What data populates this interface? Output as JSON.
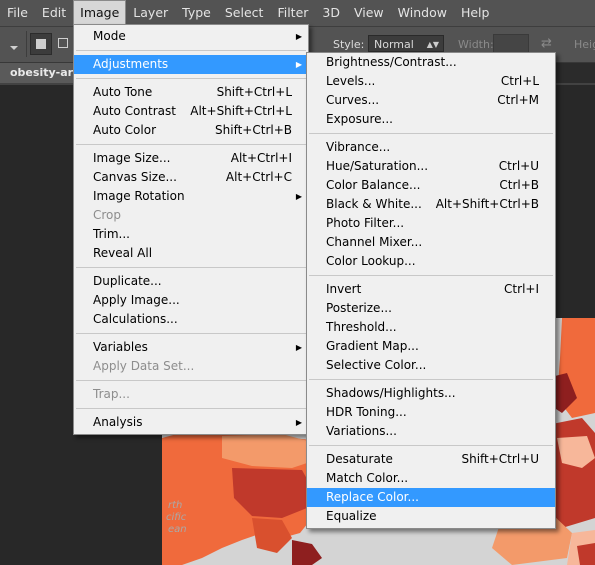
{
  "menubar": {
    "items": [
      "File",
      "Edit",
      "Image",
      "Layer",
      "Type",
      "Select",
      "Filter",
      "3D",
      "View",
      "Window",
      "Help"
    ],
    "active": "Image"
  },
  "optionsbar": {
    "style_label": "Style:",
    "style_value": "Normal",
    "width_label": "Width:",
    "height_label": "Heig"
  },
  "document": {
    "tab_label": "obesity-arou"
  },
  "map": {
    "labels": [
      "rth",
      "cific",
      "ean"
    ],
    "colors": {
      "sea": "#d4d4d4",
      "light": "#f7b79a",
      "mid": "#f06a3c",
      "dark": "#c0392b",
      "deep": "#8e1f1f",
      "pale": "#f9d3b8"
    }
  },
  "image_menu": {
    "groups": [
      [
        {
          "label": "Mode",
          "submenu": true
        }
      ],
      [
        {
          "label": "Adjustments",
          "submenu": true,
          "highlight": true
        }
      ],
      [
        {
          "label": "Auto Tone",
          "shortcut": "Shift+Ctrl+L"
        },
        {
          "label": "Auto Contrast",
          "shortcut": "Alt+Shift+Ctrl+L"
        },
        {
          "label": "Auto Color",
          "shortcut": "Shift+Ctrl+B"
        }
      ],
      [
        {
          "label": "Image Size...",
          "shortcut": "Alt+Ctrl+I"
        },
        {
          "label": "Canvas Size...",
          "shortcut": "Alt+Ctrl+C"
        },
        {
          "label": "Image Rotation",
          "submenu": true
        },
        {
          "label": "Crop",
          "disabled": true
        },
        {
          "label": "Trim..."
        },
        {
          "label": "Reveal All"
        }
      ],
      [
        {
          "label": "Duplicate..."
        },
        {
          "label": "Apply Image..."
        },
        {
          "label": "Calculations..."
        }
      ],
      [
        {
          "label": "Variables",
          "submenu": true
        },
        {
          "label": "Apply Data Set...",
          "disabled": true
        }
      ],
      [
        {
          "label": "Trap...",
          "disabled": true
        }
      ],
      [
        {
          "label": "Analysis",
          "submenu": true
        }
      ]
    ]
  },
  "adjustments_menu": {
    "groups": [
      [
        {
          "label": "Brightness/Contrast..."
        },
        {
          "label": "Levels...",
          "shortcut": "Ctrl+L"
        },
        {
          "label": "Curves...",
          "shortcut": "Ctrl+M"
        },
        {
          "label": "Exposure..."
        }
      ],
      [
        {
          "label": "Vibrance..."
        },
        {
          "label": "Hue/Saturation...",
          "shortcut": "Ctrl+U"
        },
        {
          "label": "Color Balance...",
          "shortcut": "Ctrl+B"
        },
        {
          "label": "Black & White...",
          "shortcut": "Alt+Shift+Ctrl+B"
        },
        {
          "label": "Photo Filter..."
        },
        {
          "label": "Channel Mixer..."
        },
        {
          "label": "Color Lookup..."
        }
      ],
      [
        {
          "label": "Invert",
          "shortcut": "Ctrl+I"
        },
        {
          "label": "Posterize..."
        },
        {
          "label": "Threshold..."
        },
        {
          "label": "Gradient Map..."
        },
        {
          "label": "Selective Color..."
        }
      ],
      [
        {
          "label": "Shadows/Highlights..."
        },
        {
          "label": "HDR Toning..."
        },
        {
          "label": "Variations..."
        }
      ],
      [
        {
          "label": "Desaturate",
          "shortcut": "Shift+Ctrl+U"
        },
        {
          "label": "Match Color..."
        },
        {
          "label": "Replace Color...",
          "highlight": true
        },
        {
          "label": "Equalize"
        }
      ]
    ]
  },
  "icons": {
    "ps_menu": "photoshop-logo-icon",
    "submenu_arrow": "triangle-right-icon",
    "swap": "swap-arrows-icon"
  }
}
